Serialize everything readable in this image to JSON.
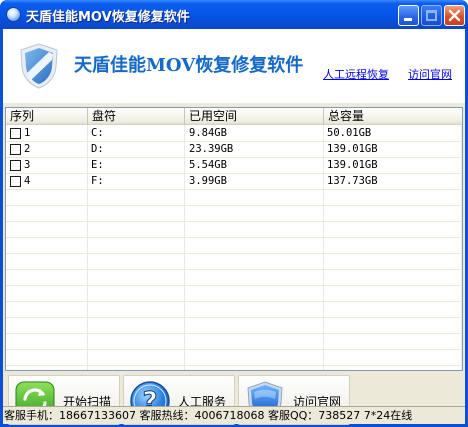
{
  "window": {
    "title": "天盾佳能MOV恢复修复软件"
  },
  "header": {
    "app_title": "天盾佳能MOV恢复修复软件",
    "link_remote": "人工远程恢复",
    "link_site": "访问官网"
  },
  "table": {
    "columns": [
      "序列",
      "盘符",
      "已用空间",
      "总容量"
    ],
    "rows": [
      {
        "index": "1",
        "drive": "C:",
        "used": "9.84GB",
        "total": "50.01GB"
      },
      {
        "index": "2",
        "drive": "D:",
        "used": "23.39GB",
        "total": "139.01GB"
      },
      {
        "index": "3",
        "drive": "E:",
        "used": "5.54GB",
        "total": "139.01GB"
      },
      {
        "index": "4",
        "drive": "F:",
        "used": "3.99GB",
        "total": "137.73GB"
      }
    ]
  },
  "buttons": {
    "scan": {
      "label": "开始扫描",
      "icon": "refresh-icon"
    },
    "service": {
      "label": "人工服务",
      "icon": "question-icon"
    },
    "website": {
      "label": "访问官网",
      "icon": "shield-icon"
    }
  },
  "status": {
    "text": "客服手机：18667133607 客服热线：4006718068 客服QQ：738527 7*24在线"
  },
  "colors": {
    "title_bar": "#0654e6",
    "app_title": "#1569c7",
    "link": "#0000ee",
    "close_button": "#d9532a"
  }
}
